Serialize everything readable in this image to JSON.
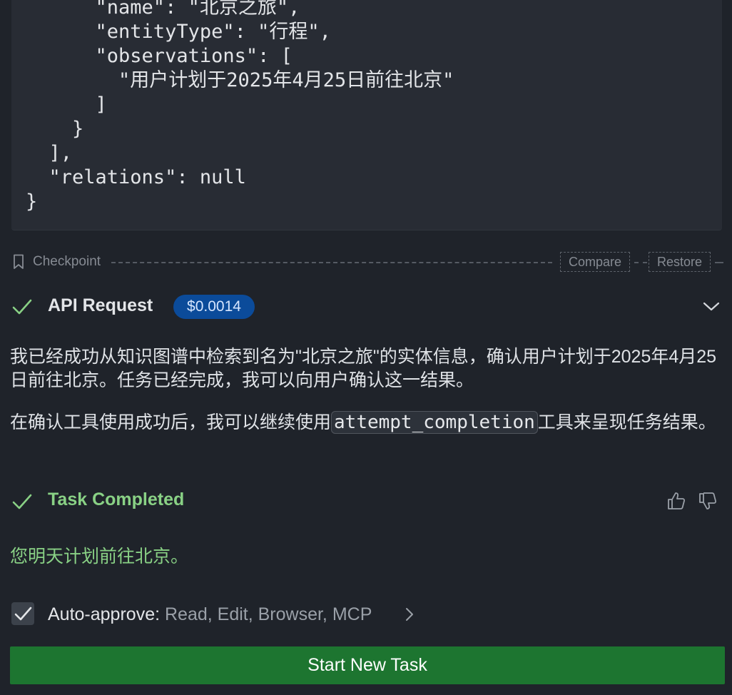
{
  "code_block": {
    "lines": [
      "      \"name\": \"北京之旅\",",
      "      \"entityType\": \"行程\",",
      "      \"observations\": [",
      "        \"用户计划于2025年4月25日前往北京\"",
      "      ]",
      "    }",
      "  ],",
      "  \"relations\": null",
      "}"
    ]
  },
  "checkpoint": {
    "label": "Checkpoint",
    "compare_label": "Compare",
    "restore_label": "Restore"
  },
  "api_request": {
    "title": "API Request",
    "cost": "$0.0014",
    "status_color": "#89d185"
  },
  "message": {
    "paragraph1": "我已经成功从知识图谱中检索到名为\"北京之旅\"的实体信息，确认用户计划于2025年4月25日前往北京。任务已经完成，我可以向用户确认这一结果。",
    "paragraph2_before": "在确认工具使用成功后，我可以继续使用",
    "paragraph2_code": "attempt_completion",
    "paragraph2_after": "工具来呈现任务结果。"
  },
  "task_completed": {
    "title": "Task Completed",
    "result": "您明天计划前往北京。",
    "color": "#89d185"
  },
  "auto_approve": {
    "label": "Auto-approve:",
    "items": "Read, Edit, Browser, MCP",
    "checked": true
  },
  "start_button": {
    "label": "Start New Task",
    "color": "#1d7530"
  },
  "icons": [
    "bookmark-icon",
    "check-icon",
    "chevron-down-icon",
    "thumbs-up-icon",
    "thumbs-down-icon",
    "checkmark-icon",
    "chevron-right-icon"
  ]
}
